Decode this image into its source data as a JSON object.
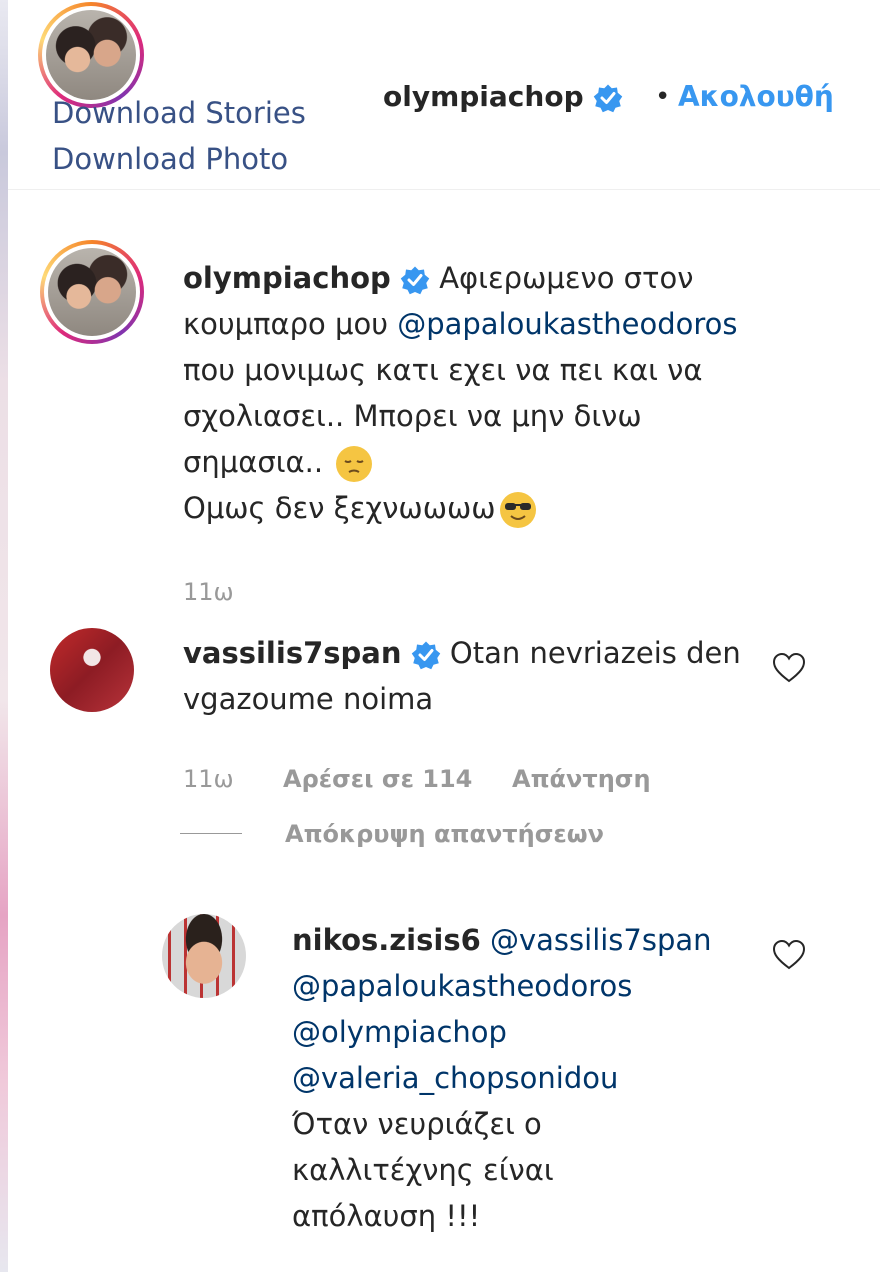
{
  "header": {
    "download_stories": "Download Stories",
    "download_photo": "Download Photo",
    "username": "olympiachop",
    "separator": "•",
    "follow_label": "Ακολουθή"
  },
  "caption": {
    "username": "olympiachop",
    "text_1": " Αφιερωμενο στον κουμπαρο μου ",
    "mention": "@papaloukastheodoros",
    "text_2": " που μονιμως κατι εχει να πει και να σχολιασει.. Μπορει να μην δινω σημασια.. ",
    "text_3": " Ομως δεν ξεχνωωωω",
    "time": "11ω"
  },
  "comment_1": {
    "username": "vassilis7span",
    "text": " Otan nevriazeis den vgazoume noima",
    "time": "11ω",
    "likes": "Αρέσει σε 114",
    "reply_label": "Απάντηση",
    "hide_replies": "Απόκρυψη απαντήσεων"
  },
  "reply_1": {
    "username": "nikos.zisis6",
    "mention_1": "@vassilis7span",
    "mention_2": "@papaloukastheodoros",
    "mention_3": "@olympiachop",
    "mention_4": "@valeria_chopsonidou",
    "text": "Όταν νευριάζει ο καλλιτέχνης είναι απόλαυση !!!"
  },
  "colors": {
    "link_blue": "#3897f0",
    "mention_blue": "#003569",
    "verified_blue": "#3897f0",
    "meta_gray": "#999999"
  },
  "icons": [
    "verified-badge-icon",
    "heart-icon",
    "pensive-emoji-icon",
    "sunglasses-emoji-icon"
  ]
}
